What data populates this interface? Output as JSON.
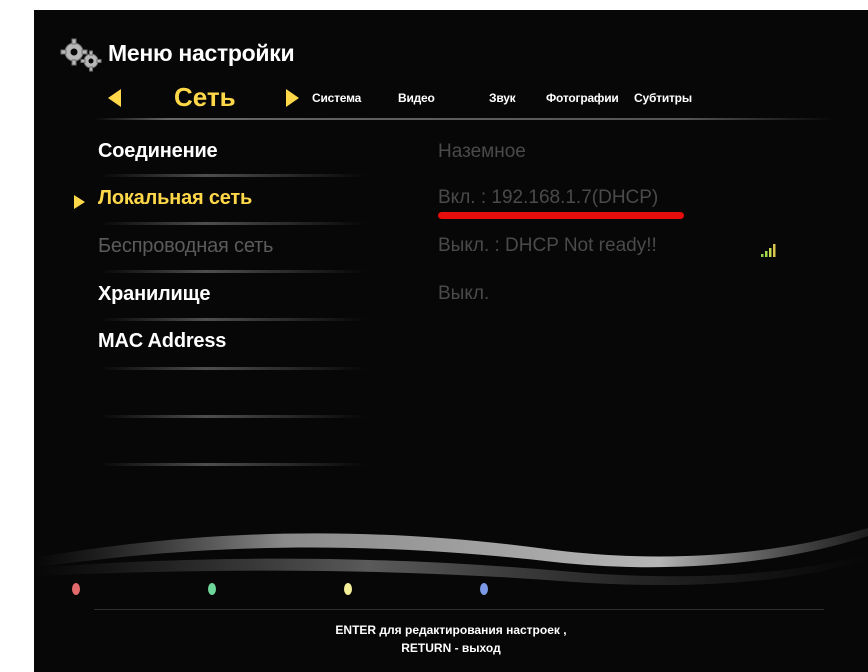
{
  "header": {
    "title": "Меню настройки",
    "icon": "gears-icon"
  },
  "tabs": {
    "active": "Сеть",
    "items": [
      "Система",
      "Видео",
      "Звук",
      "Фотографии",
      "Субтитры"
    ]
  },
  "menu": {
    "items": [
      {
        "label": "Соединение",
        "value": "Наземное",
        "state": "normal"
      },
      {
        "label": "Локальная сеть",
        "value": "Вкл. : 192.168.1.7(DHCP)",
        "state": "selected"
      },
      {
        "label": "Беспроводная сеть",
        "value": "Выкл. : DHCP Not ready!!",
        "state": "disabled"
      },
      {
        "label": "Хранилище",
        "value": "Выкл.",
        "state": "normal"
      },
      {
        "label": "MAC Address",
        "value": "",
        "state": "normal"
      }
    ]
  },
  "color_buttons": [
    {
      "name": "red",
      "color": "#e36a6a"
    },
    {
      "name": "green",
      "color": "#6fd69a"
    },
    {
      "name": "yellow",
      "color": "#f5ef9a"
    },
    {
      "name": "blue",
      "color": "#7a9ae6"
    }
  ],
  "accent_colors": {
    "selection": "#ffd84a",
    "underline": "#e80d0d"
  },
  "footer": {
    "line1": "ENTER для редактирования настроек ,",
    "line2": "RETURN - выход"
  }
}
